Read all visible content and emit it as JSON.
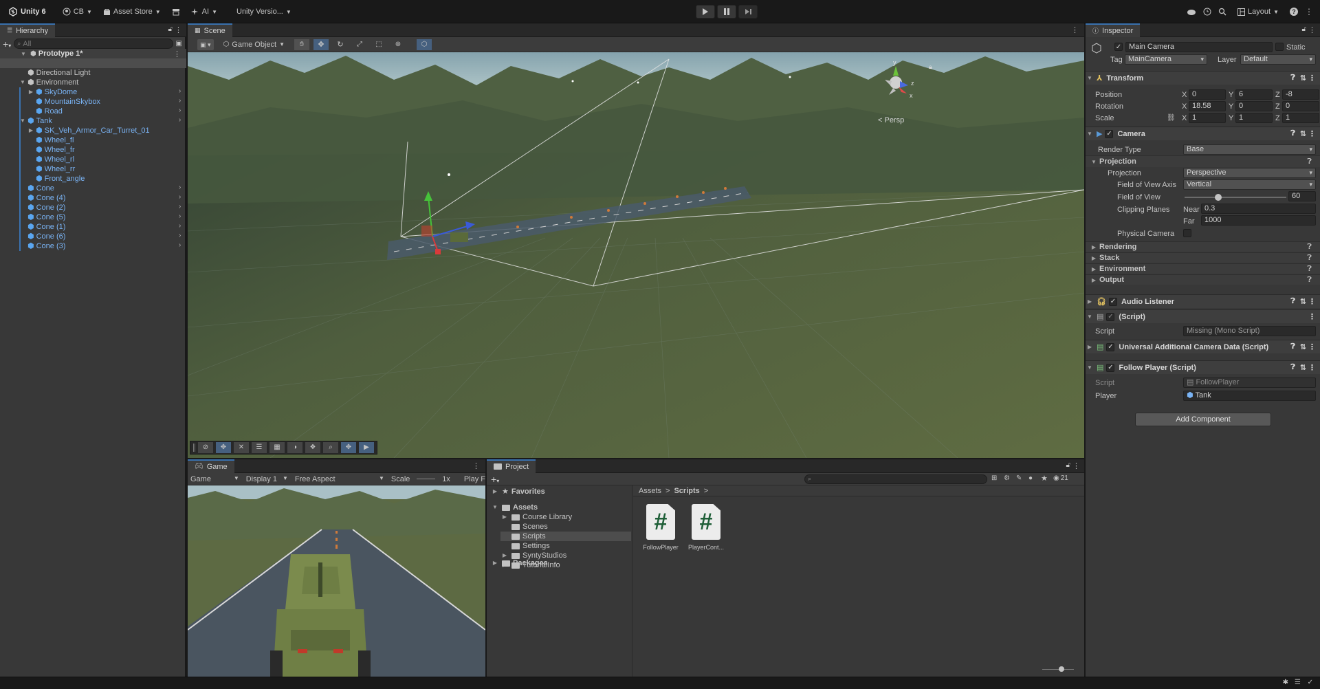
{
  "toolbar": {
    "unity_label": "Unity 6",
    "account_label": "CB",
    "asset_store_label": "Asset Store",
    "ai_label": "AI",
    "version_label": "Unity Versio...",
    "layout_label": "Layout"
  },
  "hierarchy": {
    "tab_label": "Hierarchy",
    "search_placeholder": "All",
    "scene_name": "Prototype 1*",
    "items": [
      {
        "label": "Main Camera",
        "blue": false
      },
      {
        "label": "Directional Light",
        "blue": false
      },
      {
        "label": "Environment",
        "blue": false
      },
      {
        "label": "SkyDome",
        "blue": true
      },
      {
        "label": "MountainSkybox",
        "blue": true
      },
      {
        "label": "Road",
        "blue": true
      },
      {
        "label": "Tank",
        "blue": true
      },
      {
        "label": "SK_Veh_Armor_Car_Turret_01",
        "blue": true
      },
      {
        "label": "Wheel_fl",
        "blue": true
      },
      {
        "label": "Wheel_fr",
        "blue": true
      },
      {
        "label": "Wheel_rl",
        "blue": true
      },
      {
        "label": "Wheel_rr",
        "blue": true
      },
      {
        "label": "Front_angle",
        "blue": true
      },
      {
        "label": "Cone",
        "blue": true
      },
      {
        "label": "Cone (4)",
        "blue": true
      },
      {
        "label": "Cone (2)",
        "blue": true
      },
      {
        "label": "Cone (5)",
        "blue": true
      },
      {
        "label": "Cone (1)",
        "blue": true
      },
      {
        "label": "Cone (6)",
        "blue": true
      },
      {
        "label": "Cone (3)",
        "blue": true
      }
    ]
  },
  "scene": {
    "tab_label": "Scene",
    "gameobject_label": "Game Object",
    "persp_label": "< Persp",
    "gizmo_x": "x",
    "gizmo_y": "y",
    "gizmo_z": "z"
  },
  "game": {
    "tab_label": "Game",
    "mode_label": "Game",
    "display_label": "Display 1",
    "aspect_label": "Free Aspect",
    "scale_label": "Scale",
    "scale_value": "1x",
    "play_label": "Play F"
  },
  "project": {
    "tab_label": "Project",
    "favorites_label": "Favorites",
    "assets_label": "Assets",
    "folders": [
      "Course Library",
      "Scenes",
      "Scripts",
      "Settings",
      "SyntyStudios",
      "TutorialInfo"
    ],
    "packages_label": "Packages",
    "breadcrumb_root": "Assets",
    "breadcrumb_current": "Scripts",
    "files": [
      "FollowPlayer",
      "PlayerCont..."
    ],
    "hidden_count": "21",
    "file_glyph": "#"
  },
  "inspector": {
    "tab_label": "Inspector",
    "object_name": "Main Camera",
    "static_label": "Static",
    "tag_label": "Tag",
    "tag_value": "MainCamera",
    "layer_label": "Layer",
    "layer_value": "Default",
    "transform": {
      "title": "Transform",
      "position_label": "Position",
      "rotation_label": "Rotation",
      "scale_label": "Scale",
      "position": [
        "0",
        "6",
        "-8"
      ],
      "rotation": [
        "18.58",
        "0",
        "0"
      ],
      "scale": [
        "1",
        "1",
        "1"
      ],
      "axis_x": "X",
      "axis_y": "Y",
      "axis_z": "Z"
    },
    "camera": {
      "title": "Camera",
      "render_type_label": "Render Type",
      "render_type_value": "Base",
      "projection_section": "Projection",
      "projection_label": "Projection",
      "projection_value": "Perspective",
      "fov_axis_label": "Field of View Axis",
      "fov_axis_value": "Vertical",
      "fov_label": "Field of View",
      "fov_value": "60",
      "fov_slider_fraction": 0.33,
      "clipping_label": "Clipping Planes",
      "near_label": "Near",
      "near_value": "0.3",
      "far_label": "Far",
      "far_value": "1000",
      "physical_label": "Physical Camera",
      "rendering_label": "Rendering",
      "stack_label": "Stack",
      "environment_label": "Environment",
      "output_label": "Output"
    },
    "audio_listener_title": "Audio Listener",
    "missing_script": {
      "title": "(Script)",
      "script_label": "Script",
      "script_value": "Missing (Mono Script)"
    },
    "uacd_title": "Universal Additional Camera Data (Script)",
    "follow_player": {
      "title": "Follow Player (Script)",
      "script_label": "Script",
      "script_value": "FollowPlayer",
      "player_label": "Player",
      "player_value": "Tank"
    },
    "add_component_label": "Add Component"
  },
  "colors": {
    "accent": "#3a72b0",
    "prefab_blue": "#7ab4f5",
    "panel": "#383838",
    "ground": "#56633f"
  }
}
